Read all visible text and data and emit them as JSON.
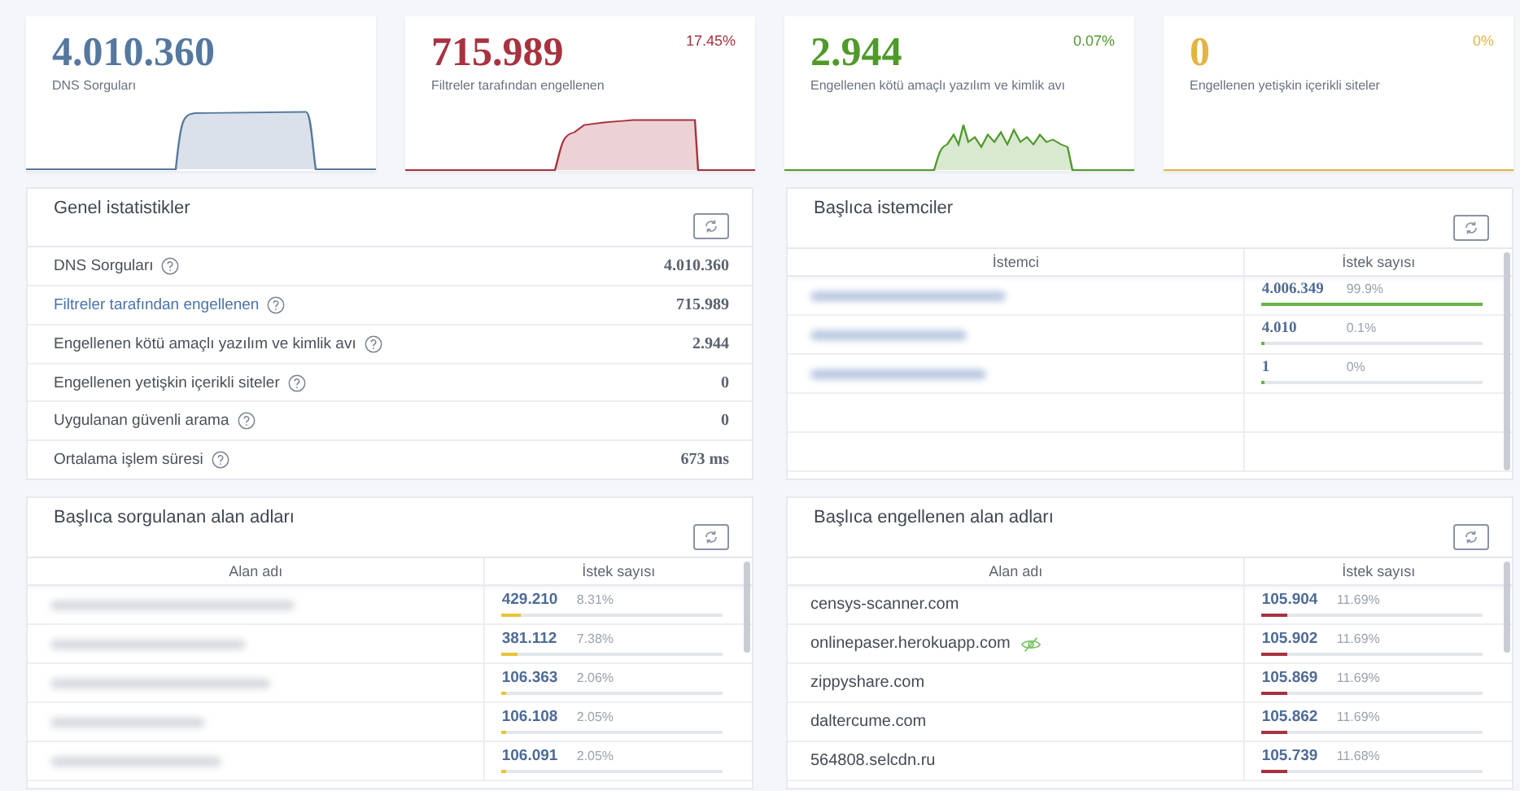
{
  "summary_cards": [
    {
      "value": "4.010.360",
      "label": "DNS Sorguları",
      "color": "#56789f"
    },
    {
      "value": "715.989",
      "label": "Filtreler tarafından engellenen",
      "percent": "17.45%",
      "color": "#a8323f"
    },
    {
      "value": "2.944",
      "label": "Engellenen kötü amaçlı yazılım ve kimlik avı",
      "percent": "0.07%",
      "color": "#4f9a2a"
    },
    {
      "value": "0",
      "label": "Engellenen yetişkin içerikli siteler",
      "percent": "0%",
      "color": "#e2b443"
    }
  ],
  "general_stats": {
    "title": "Genel istatistikler",
    "rows": [
      {
        "label": "DNS Sorguları",
        "value": "4.010.360",
        "link": false
      },
      {
        "label": "Filtreler tarafından engellenen",
        "value": "715.989",
        "link": true
      },
      {
        "label": "Engellenen kötü amaçlı yazılım ve kimlik avı",
        "value": "2.944",
        "link": false
      },
      {
        "label": "Engellenen yetişkin içerikli siteler",
        "value": "0",
        "link": false
      },
      {
        "label": "Uygulanan güvenli arama",
        "value": "0",
        "link": false
      },
      {
        "label": "Ortalama işlem süresi",
        "value": "673 ms",
        "link": false
      }
    ]
  },
  "top_clients": {
    "title": "Başlıca istemciler",
    "columns": [
      "İstemci",
      "İstek sayısı"
    ],
    "rows": [
      {
        "kind": "blurred",
        "count": "4.006.349",
        "percent": "99.9%",
        "level": 0.999
      },
      {
        "kind": "blurred",
        "count": "4.010",
        "percent": "0.1%",
        "level": 0.001
      },
      {
        "kind": "blurred",
        "count": "1",
        "percent": "0%",
        "level": 0
      }
    ]
  },
  "top_queried_domains": {
    "title": "Başlıca sorgulanan alan adları",
    "columns": [
      "Alan adı",
      "İstek sayısı"
    ],
    "rows": [
      {
        "kind": "blurred",
        "count": "429.210",
        "percent": "8.31%",
        "level": 0.0831
      },
      {
        "kind": "blurred",
        "count": "381.112",
        "percent": "7.38%",
        "level": 0.0738
      },
      {
        "kind": "blurred",
        "count": "106.363",
        "percent": "2.06%",
        "level": 0.0206
      },
      {
        "kind": "blurred",
        "count": "106.108",
        "percent": "2.05%",
        "level": 0.0205
      },
      {
        "kind": "blurred",
        "count": "106.091",
        "percent": "2.05%",
        "level": 0.0205
      }
    ]
  },
  "top_blocked_domains": {
    "title": "Başlıca engellenen alan adları",
    "columns": [
      "Alan adı",
      "İstek sayısı"
    ],
    "rows": [
      {
        "kind": "text",
        "name": "censys-scanner.com",
        "tracker": false,
        "count": "105.904",
        "percent": "11.69%",
        "level": 0.1169
      },
      {
        "kind": "text",
        "name": "onlinepaser.herokuapp.com",
        "tracker": true,
        "count": "105.902",
        "percent": "11.69%",
        "level": 0.1169
      },
      {
        "kind": "text",
        "name": "zippyshare.com",
        "tracker": false,
        "count": "105.869",
        "percent": "11.69%",
        "level": 0.1169
      },
      {
        "kind": "text",
        "name": "daltercume.com",
        "tracker": false,
        "count": "105.862",
        "percent": "11.69%",
        "level": 0.1169
      },
      {
        "kind": "text",
        "name": "564808.selcdn.ru",
        "tracker": false,
        "count": "105.739",
        "percent": "11.68%",
        "level": 0.1168
      }
    ]
  }
}
